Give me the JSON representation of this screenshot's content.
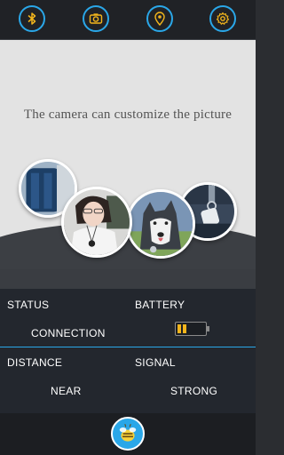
{
  "toolbar": {
    "items": [
      {
        "icon": "bluetooth-icon"
      },
      {
        "icon": "camera-icon"
      },
      {
        "icon": "location-pin-icon"
      },
      {
        "icon": "gear-icon"
      }
    ],
    "accent": "#2aa7e8"
  },
  "hero": {
    "caption": "The camera can customize the picture",
    "images": [
      {
        "subject": "backpack"
      },
      {
        "subject": "woman-with-pendant"
      },
      {
        "subject": "husky-dog"
      },
      {
        "subject": "keychain-tag"
      }
    ]
  },
  "status": {
    "status_label": "STATUS",
    "status_value": "CONNECTION",
    "battery_label": "BATTERY",
    "battery_level": 0.4,
    "battery_color": "#f2b51c",
    "distance_label": "DISTANCE",
    "distance_value": "NEAR",
    "signal_label": "SIGNAL",
    "signal_value": "STRONG"
  },
  "bottom": {
    "center_icon": "bee-logo-icon"
  }
}
